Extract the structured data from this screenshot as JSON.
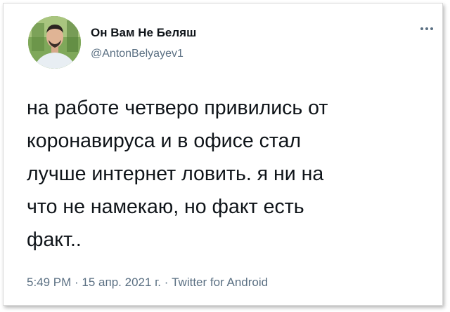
{
  "author": {
    "display_name": "Он Вам Не Беляш",
    "handle": "@AntonBelyayev1"
  },
  "tweet": {
    "lines": [
      "на работе четверо привились от",
      "коронавируса и в офисе стал",
      "лучше интернет ловить. я ни на",
      "что не намекаю, но факт есть",
      "факт.."
    ]
  },
  "meta": {
    "text": "5:49 PM · 15 апр. 2021 г. · Twitter for Android"
  },
  "icons": {
    "more": "more-horizontal-icon",
    "avatar": "profile-photo"
  },
  "colors": {
    "text_primary": "#0f1419",
    "text_secondary": "#5b7083",
    "background": "#ffffff"
  }
}
